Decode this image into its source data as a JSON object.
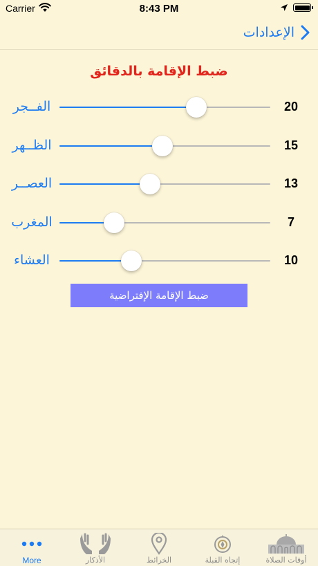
{
  "status_bar": {
    "carrier": "Carrier",
    "time": "8:43 PM"
  },
  "nav": {
    "back_label": "الإعدادات"
  },
  "section": {
    "title": "ضبط الإقامة بالدقائق"
  },
  "settings": [
    {
      "prayer": "الفــجر",
      "value": "20",
      "slider_fraction": 0.65
    },
    {
      "prayer": "الظــهر",
      "value": "15",
      "slider_fraction": 0.49
    },
    {
      "prayer": "العصــر",
      "value": "13",
      "slider_fraction": 0.43
    },
    {
      "prayer": "المغرب",
      "value": "7",
      "slider_fraction": 0.26
    },
    {
      "prayer": "العشاء",
      "value": "10",
      "slider_fraction": 0.34
    }
  ],
  "reset_button": {
    "label": "ضبط الإقامة الإفتراضية"
  },
  "tabs": [
    {
      "label": "More",
      "icon": "more-dots-icon",
      "active": true
    },
    {
      "label": "الأذكار",
      "icon": "praying-hands-icon",
      "active": false
    },
    {
      "label": "الخرائط",
      "icon": "map-pin-icon",
      "active": false
    },
    {
      "label": "إتجاه القبلة",
      "icon": "qibla-compass-icon",
      "active": false
    },
    {
      "label": "أوقات الصلاة",
      "icon": "mosque-dome-icon",
      "active": false
    }
  ],
  "colors": {
    "background": "#fdf5d8",
    "accent_blue": "#1e7cf2",
    "title_red": "#e2251c",
    "button_purple": "#7d7dfb",
    "tab_inactive": "#8c8c8c"
  }
}
